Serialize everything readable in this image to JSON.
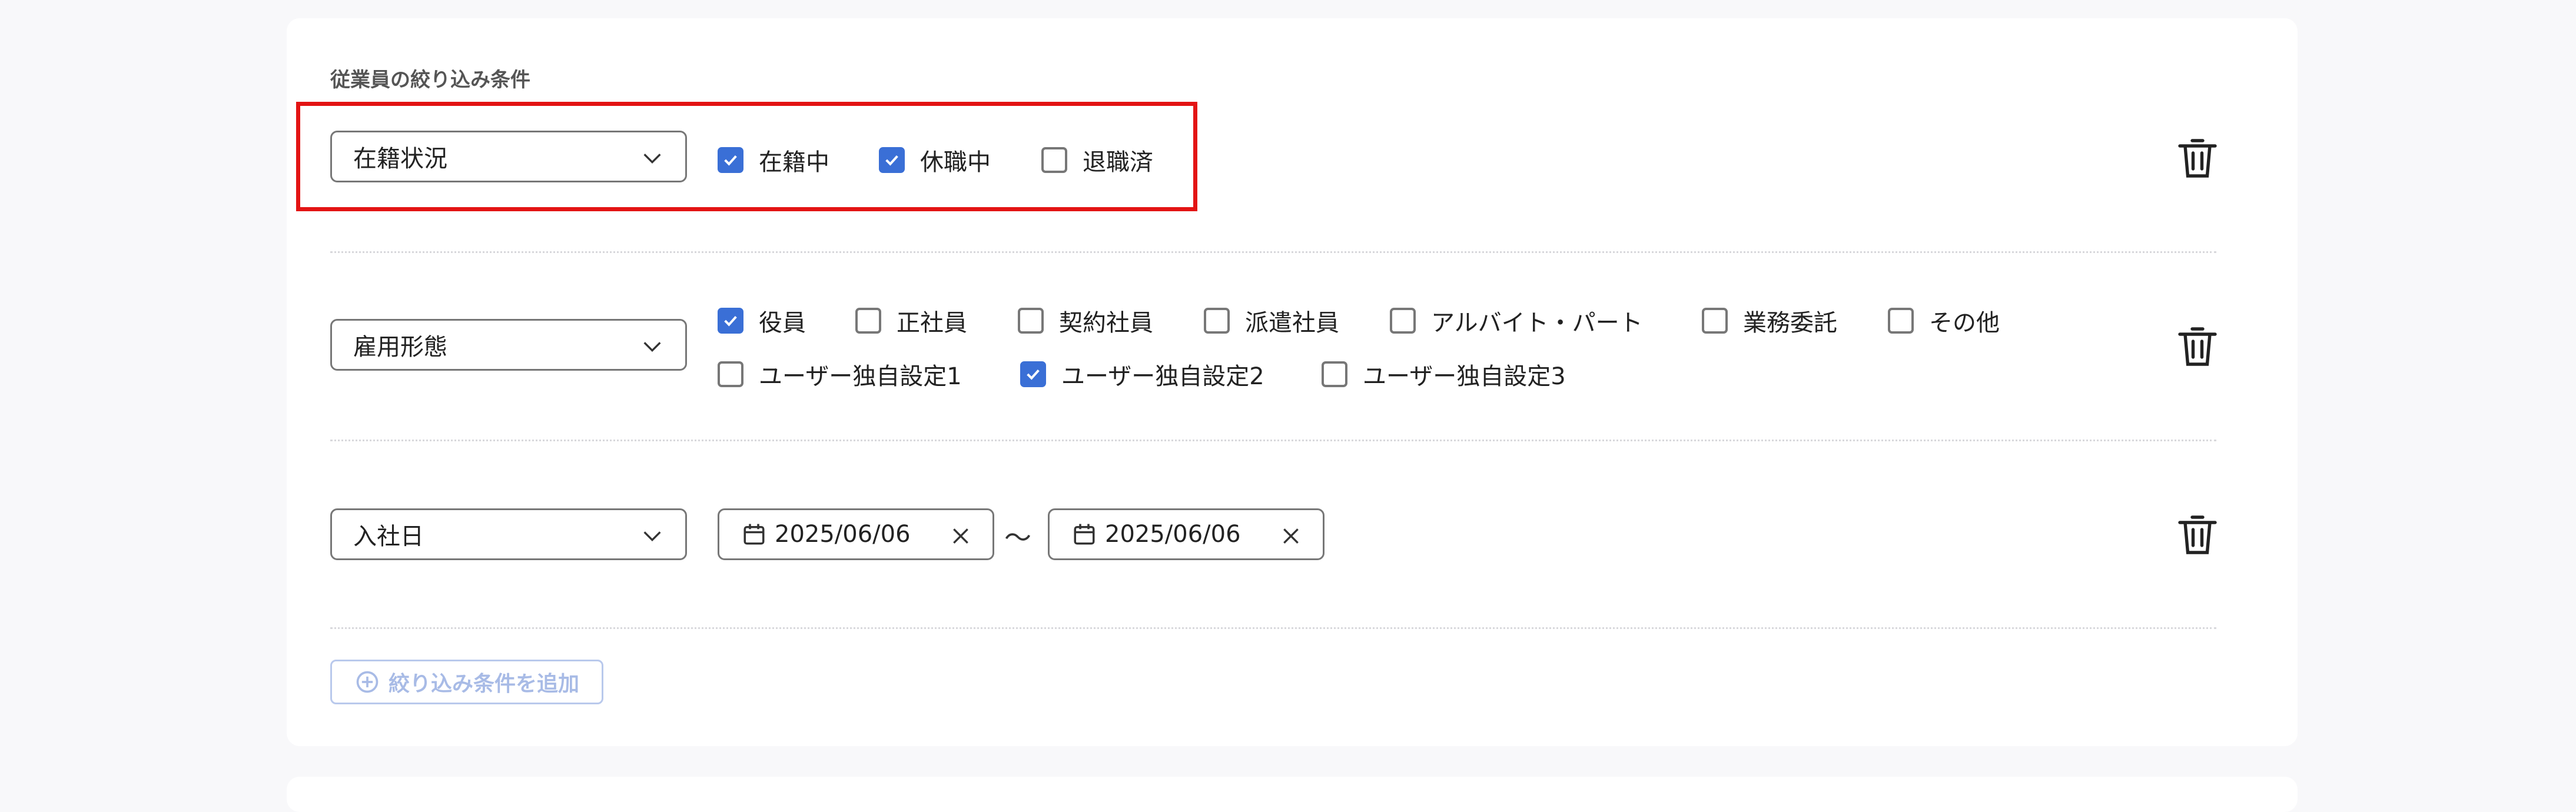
{
  "section_title": "従業員の絞り込み条件",
  "filters": [
    {
      "field": "在籍状況",
      "options": [
        {
          "label": "在籍中",
          "checked": true
        },
        {
          "label": "休職中",
          "checked": true
        },
        {
          "label": "退職済",
          "checked": false
        }
      ]
    },
    {
      "field": "雇用形態",
      "options": [
        {
          "label": "役員",
          "checked": true
        },
        {
          "label": "正社員",
          "checked": false
        },
        {
          "label": "契約社員",
          "checked": false
        },
        {
          "label": "派遣社員",
          "checked": false
        },
        {
          "label": "アルバイト・パート",
          "checked": false
        },
        {
          "label": "業務委託",
          "checked": false
        },
        {
          "label": "その他",
          "checked": false
        },
        {
          "label": "ユーザー独自設定1",
          "checked": false
        },
        {
          "label": "ユーザー独自設定2",
          "checked": true
        },
        {
          "label": "ユーザー独自設定3",
          "checked": false
        }
      ]
    },
    {
      "field": "入社日",
      "date_from": "2025/06/06",
      "separator": "〜",
      "date_to": "2025/06/06"
    }
  ],
  "add_button_label": "絞り込み条件を追加",
  "colors": {
    "accent": "#3a6fd6",
    "highlight": "#e31414",
    "disabled_text": "#a8bbe6"
  },
  "icons": {
    "dropdown": "chevron-down-icon",
    "checkbox_mark": "check-icon",
    "delete": "trash-icon",
    "calendar": "calendar-icon",
    "clear": "close-icon",
    "add": "plus-circle-icon"
  }
}
